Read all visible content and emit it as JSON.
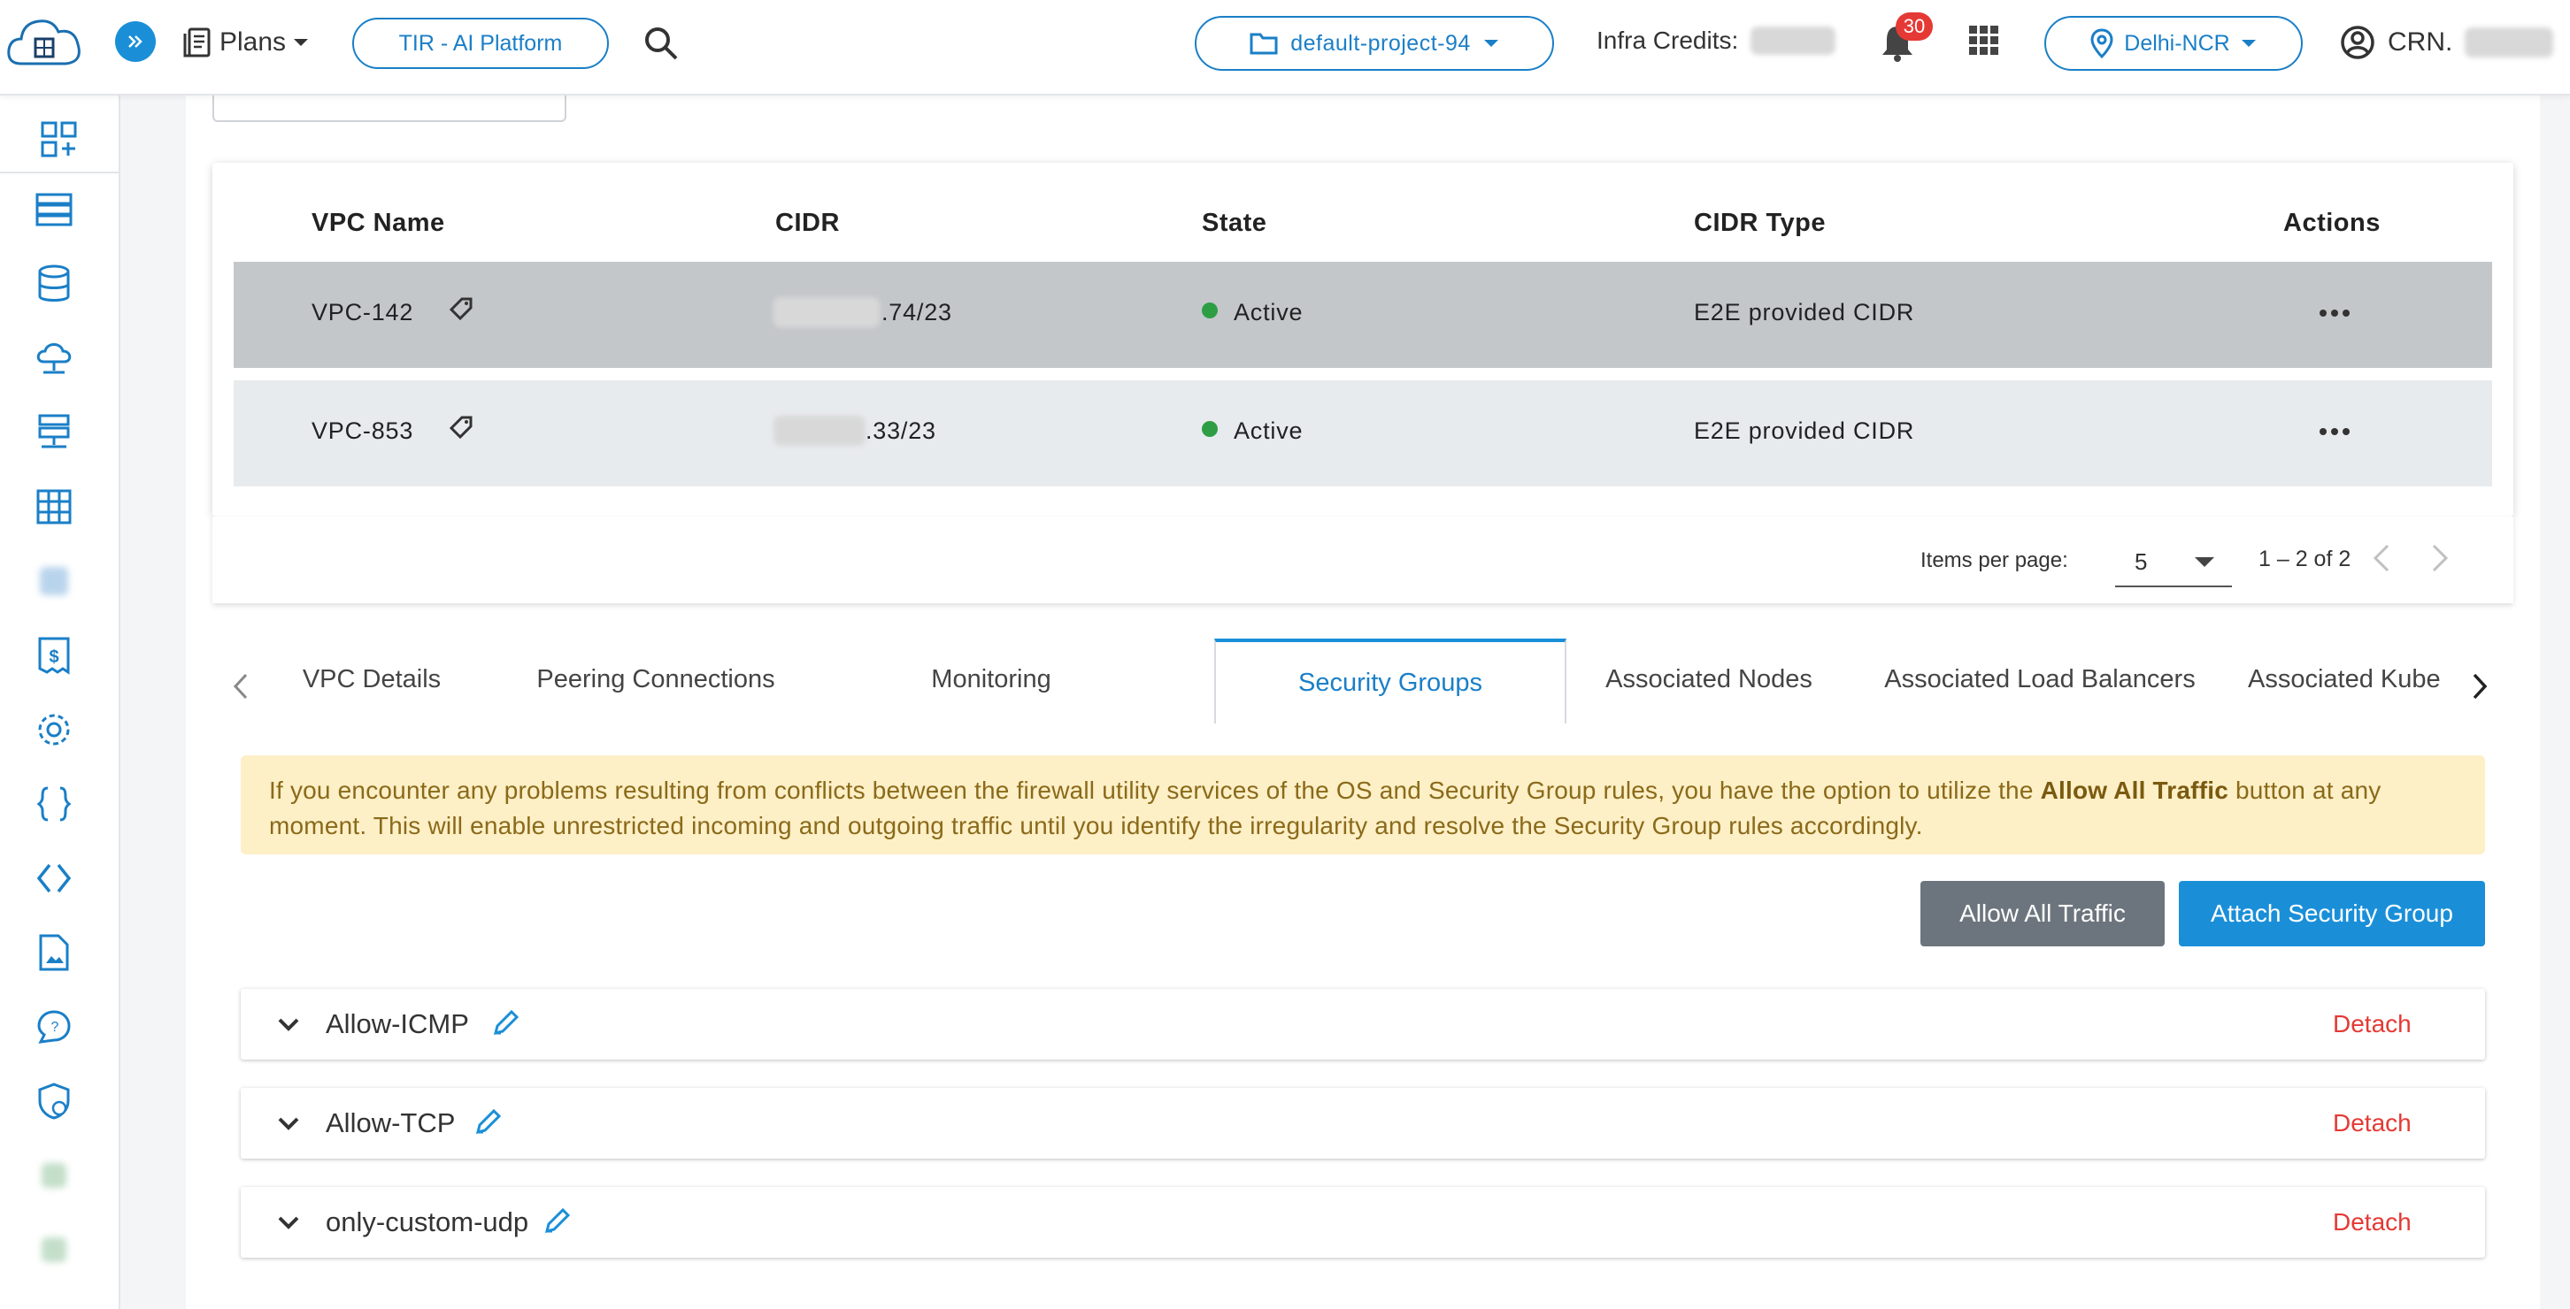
{
  "header": {
    "plans_label": "Plans",
    "tir_label": "TIR - AI Platform",
    "project_label": "default-project-94",
    "credits_label": "Infra Credits:",
    "notification_count": "30",
    "region_label": "Delhi-NCR",
    "user_label": "CRN."
  },
  "table": {
    "columns": [
      "VPC Name",
      "CIDR",
      "State",
      "CIDR Type",
      "Actions"
    ],
    "rows": [
      {
        "name": "VPC-142",
        "cidr": ".74/23",
        "state": "Active",
        "cidr_type": "E2E provided CIDR"
      },
      {
        "name": "VPC-853",
        "cidr": ".33/23",
        "state": "Active",
        "cidr_type": "E2E provided CIDR"
      }
    ]
  },
  "pagination": {
    "items_per_page_label": "Items per page:",
    "items_per_page": "5",
    "range": "1 – 2 of 2"
  },
  "tabs": [
    "VPC Details",
    "Peering Connections",
    "Monitoring",
    "Security Groups",
    "Associated Nodes",
    "Associated Load Balancers",
    "Associated Kube"
  ],
  "alert": {
    "text_1": "If you encounter any problems resulting from conflicts between the firewall utility services of the OS and Security Group rules, you have the option to utilize the ",
    "bold": "Allow All Traffic",
    "text_2": " button at any moment. This will enable unrestricted incoming and outgoing traffic until you identify the irregularity and resolve the Security Group rules accordingly."
  },
  "buttons": {
    "allow_all": "Allow All Traffic",
    "attach": "Attach Security Group"
  },
  "security_groups": [
    {
      "name": "Allow-ICMP",
      "action": "Detach"
    },
    {
      "name": "Allow-TCP",
      "action": "Detach"
    },
    {
      "name": "only-custom-udp",
      "action": "Detach"
    }
  ],
  "colors": {
    "accent": "#1a8fd8",
    "active_dot": "#2e9e44",
    "detach": "#e53935",
    "alert_bg": "#fdefc6"
  }
}
